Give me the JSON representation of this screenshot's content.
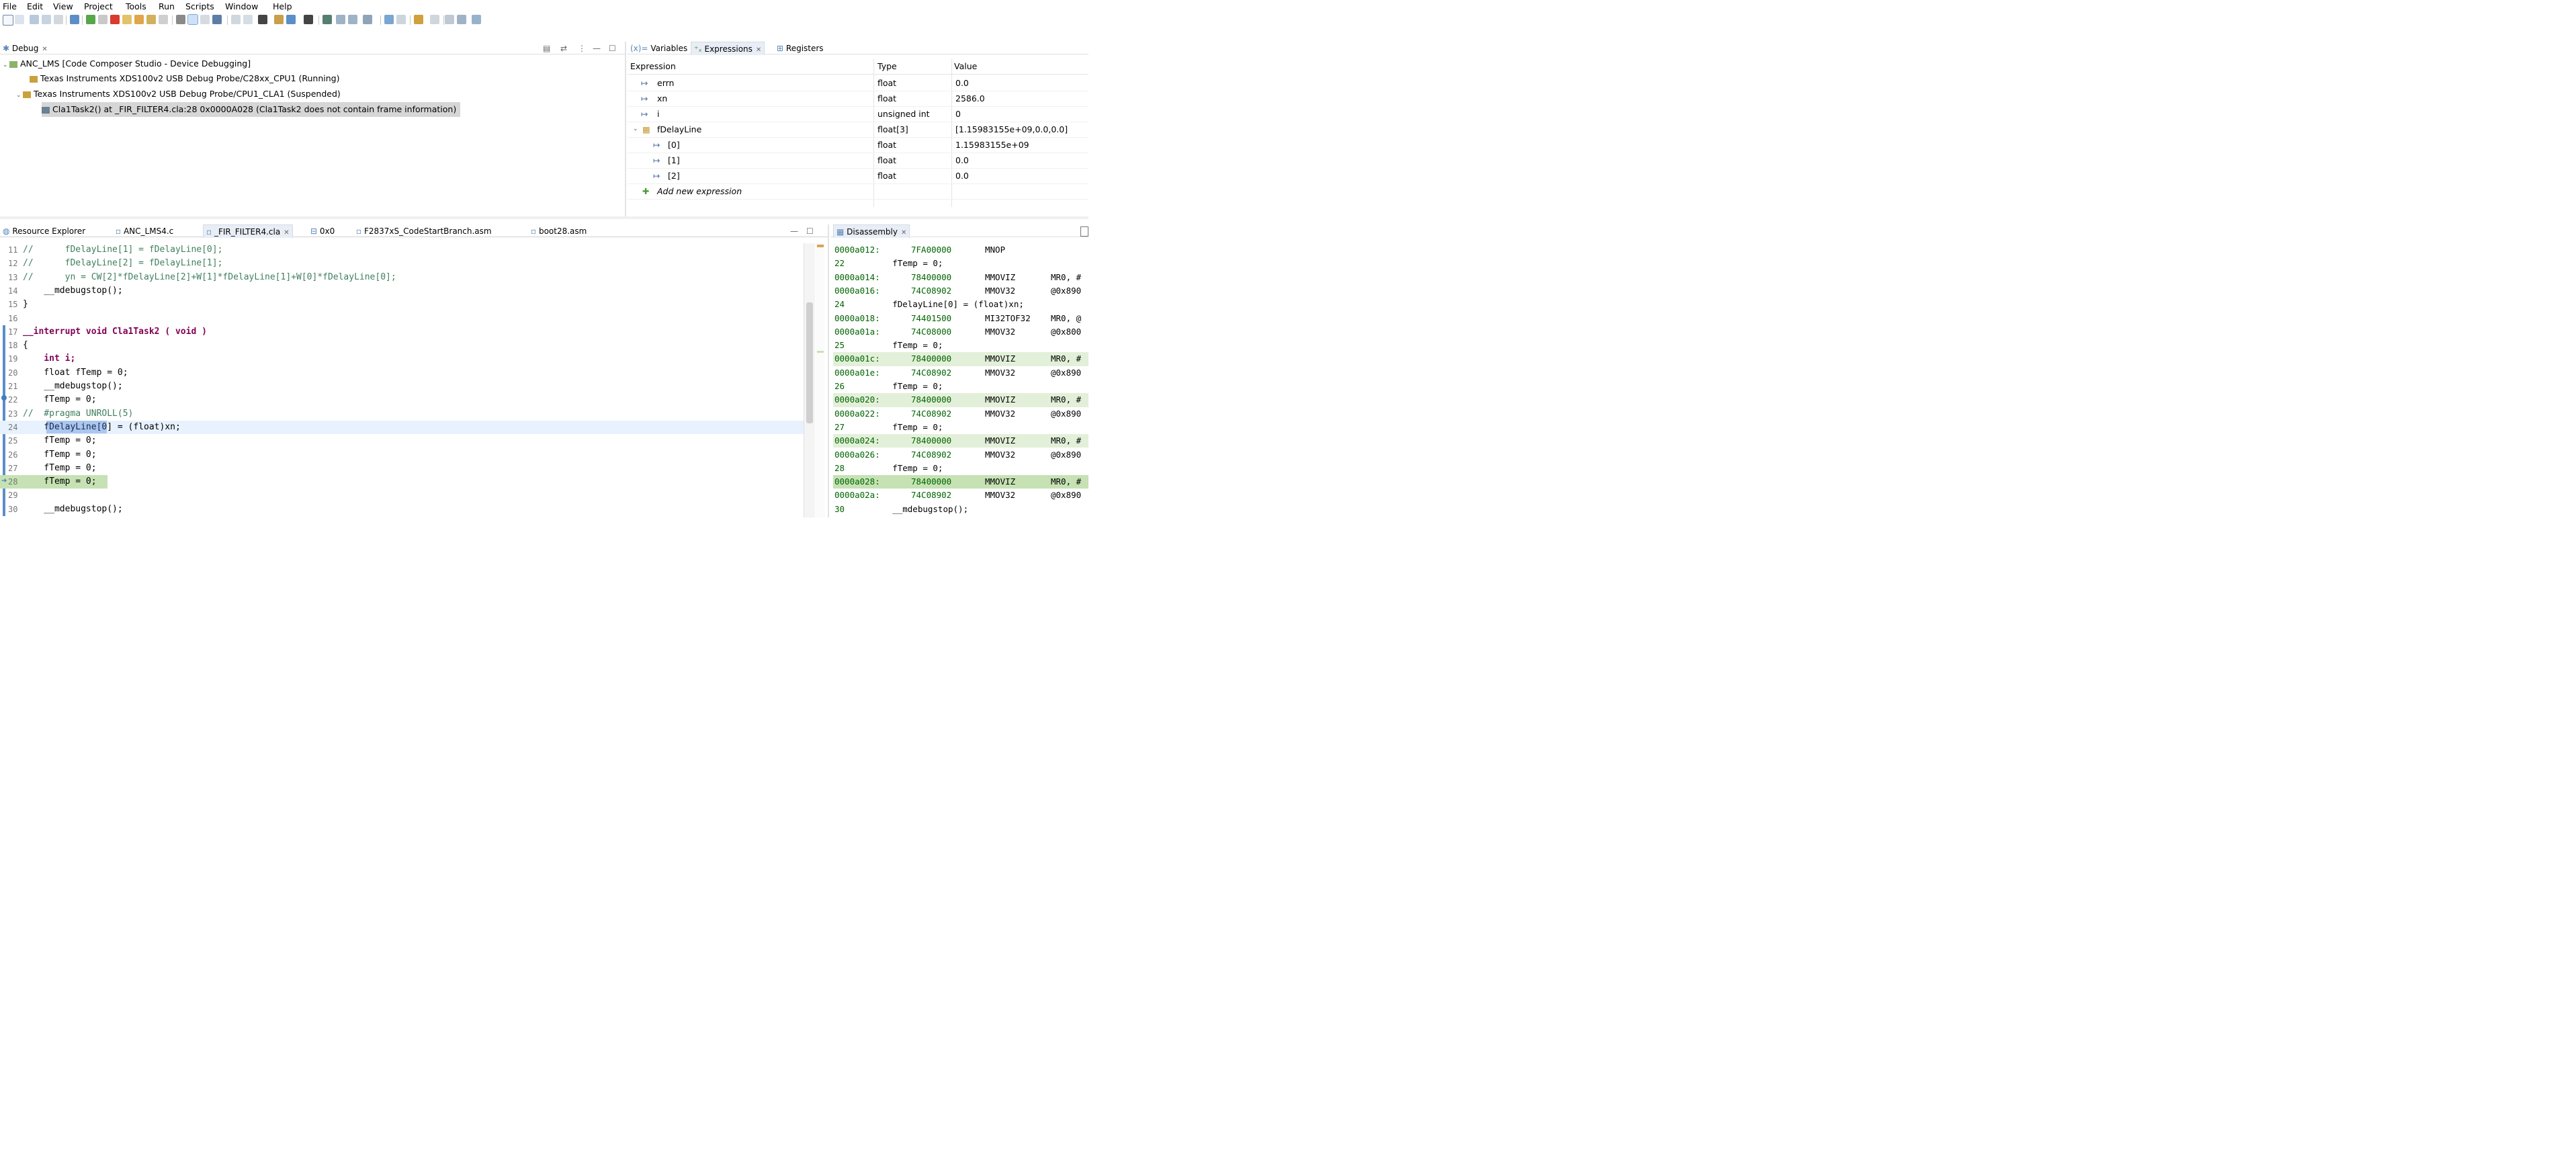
{
  "menu": [
    "File",
    "Edit",
    "View",
    "Project",
    "Tools",
    "Run",
    "Scripts",
    "Window",
    "Help"
  ],
  "debug_panel": {
    "tab_label": "Debug",
    "tree": [
      {
        "label": "ANC_LMS [Code Composer Studio - Device Debugging]",
        "level": 0
      },
      {
        "label": "Texas Instruments XDS100v2 USB Debug Probe/C28xx_CPU1 (Running)",
        "level": 1
      },
      {
        "label": "Texas Instruments XDS100v2 USB Debug Probe/CPU1_CLA1 (Suspended)",
        "level": 1
      },
      {
        "label": "Cla1Task2() at _FIR_FILTER4.cla:28 0x0000A028  (Cla1Task2 does not contain frame information)",
        "level": 2
      }
    ]
  },
  "variables_panel": {
    "tabs": [
      "Variables",
      "Expressions",
      "Registers"
    ],
    "headers": [
      "Expression",
      "Type",
      "Value"
    ],
    "rows": [
      {
        "expr": "errn",
        "type": "float",
        "value": "0.0",
        "indent": 0
      },
      {
        "expr": "xn",
        "type": "float",
        "value": "2586.0",
        "indent": 0
      },
      {
        "expr": "i",
        "type": "unsigned int",
        "value": "0",
        "indent": 0
      },
      {
        "expr": "fDelayLine",
        "type": "float[3]",
        "value": "[1.15983155e+09,0.0,0.0]",
        "indent": 0
      },
      {
        "expr": "[0]",
        "type": "float",
        "value": "1.15983155e+09",
        "indent": 1
      },
      {
        "expr": "[1]",
        "type": "float",
        "value": "0.0",
        "indent": 1
      },
      {
        "expr": "[2]",
        "type": "float",
        "value": "0.0",
        "indent": 1
      }
    ],
    "add_new": "Add new expression"
  },
  "editor_tabs": [
    "Resource Explorer",
    "ANC_LMS4.c",
    "_FIR_FILTER4.cla",
    "0x0",
    "F2837xS_CodeStartBranch.asm",
    "boot28.asm"
  ],
  "disasm_tab": "Disassembly",
  "code": [
    {
      "n": "11",
      "t": "//      fDelayLine[1] = fDelayLine[0];"
    },
    {
      "n": "12",
      "t": "//      fDelayLine[2] = fDelayLine[1];"
    },
    {
      "n": "13",
      "t": "//      yn = CW[2]*fDelayLine[2]+W[1]*fDelayLine[1]+W[0]*fDelayLine[0];"
    },
    {
      "n": "14",
      "t": "    __mdebugstop();"
    },
    {
      "n": "15",
      "t": "}"
    },
    {
      "n": "16",
      "t": ""
    },
    {
      "n": "17",
      "t": "__interrupt void Cla1Task2 ( void )"
    },
    {
      "n": "18",
      "t": "{"
    },
    {
      "n": "19",
      "t": "    int i;"
    },
    {
      "n": "20",
      "t": "    float fTemp = 0;"
    },
    {
      "n": "21",
      "t": "    __mdebugstop();"
    },
    {
      "n": "22",
      "t": "    fTemp = 0;"
    },
    {
      "n": "23",
      "t": "//  #pragma UNROLL(5)"
    },
    {
      "n": "24",
      "t": "    fDelayLine[0] = (float)xn;"
    },
    {
      "n": "25",
      "t": "    fTemp = 0;"
    },
    {
      "n": "26",
      "t": "    fTemp = 0;"
    },
    {
      "n": "27",
      "t": "    fTemp = 0;"
    },
    {
      "n": "28",
      "t": "    fTemp = 0;"
    },
    {
      "n": "29",
      "t": ""
    },
    {
      "n": "30",
      "t": "    __mdebugstop();"
    }
  ],
  "disasm": [
    {
      "a": "0000a012:",
      "h": "7FA00000",
      "m": "MNOP",
      "o": ""
    },
    {
      "s": "22",
      "src": "        fTemp = 0;"
    },
    {
      "a": "0000a014:",
      "h": "78400000",
      "m": "MMOVIZ",
      "o": "MR0, #"
    },
    {
      "a": "0000a016:",
      "h": "74C08902",
      "m": "MMOV32",
      "o": "@0x890"
    },
    {
      "s": "24",
      "src": "        fDelayLine[0] = (float)xn;"
    },
    {
      "a": "0000a018:",
      "h": "74401500",
      "m": "MI32TOF32",
      "o": "MR0, @"
    },
    {
      "a": "0000a01a:",
      "h": "74C08000",
      "m": "MMOV32",
      "o": "@0x800"
    },
    {
      "s": "25",
      "src": "        fTemp = 0;"
    },
    {
      "a": "0000a01c:",
      "h": "78400000",
      "m": "MMOVIZ",
      "o": "MR0, #"
    },
    {
      "a": "0000a01e:",
      "h": "74C08902",
      "m": "MMOV32",
      "o": "@0x890"
    },
    {
      "s": "26",
      "src": "        fTemp = 0;"
    },
    {
      "a": "0000a020:",
      "h": "78400000",
      "m": "MMOVIZ",
      "o": "MR0, #"
    },
    {
      "a": "0000a022:",
      "h": "74C08902",
      "m": "MMOV32",
      "o": "@0x890"
    },
    {
      "s": "27",
      "src": "        fTemp = 0;"
    },
    {
      "a": "0000a024:",
      "h": "78400000",
      "m": "MMOVIZ",
      "o": "MR0, #"
    },
    {
      "a": "0000a026:",
      "h": "74C08902",
      "m": "MMOV32",
      "o": "@0x890"
    },
    {
      "s": "28",
      "src": "        fTemp = 0;"
    },
    {
      "a": "0000a028:",
      "h": "78400000",
      "m": "MMOVIZ",
      "o": "MR0, #"
    },
    {
      "a": "0000a02a:",
      "h": "74C08902",
      "m": "MMOV32",
      "o": "@0x890"
    },
    {
      "s": "30",
      "src": "        __mdebugstop();"
    }
  ]
}
